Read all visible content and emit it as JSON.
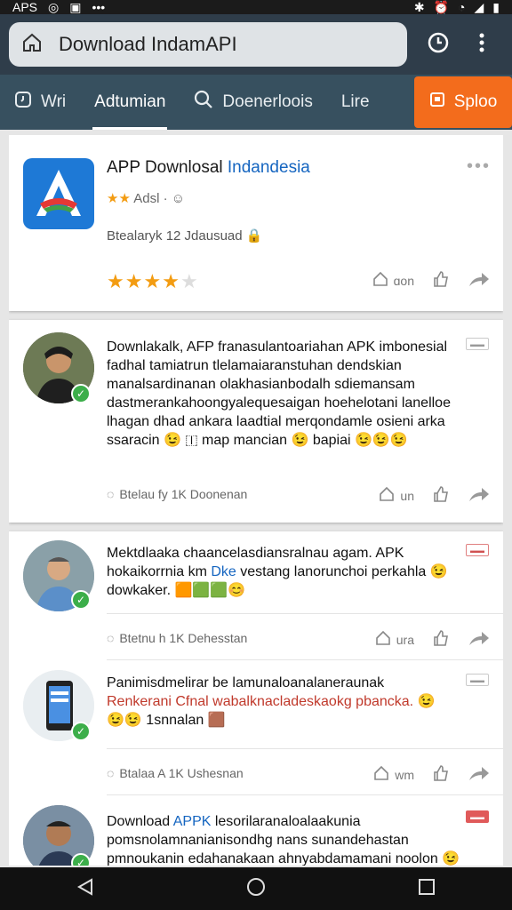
{
  "status": {
    "left_label": "APS"
  },
  "urlbar": {
    "url": "Download IndamAPI"
  },
  "tabs": [
    {
      "label": "Wri"
    },
    {
      "label": "Adtumian"
    },
    {
      "label": "Doenerloois"
    },
    {
      "label": "Lire"
    },
    {
      "label": "Sploo"
    }
  ],
  "app_card": {
    "title_part1": "APP Downlosal ",
    "title_part2": "Indandesia",
    "sub": "Adsl · ☺",
    "meta": "Btealaryk 12 Jdausuad",
    "rating": 4,
    "rating_max": 5,
    "share_label": "ɑon"
  },
  "posts": [
    {
      "text": "Downlakalk, AFP franasulantoariahan APK imbonesial fadhal tamiatrun tlelamaiaranstuhan dendskian manalsardinanan olakhasianbodalh sdiemansam dastmerankahoongyalequesaigan hoehelotani lanelloe lhagan dhad ankara laadtial merqondamle osieni arka ssaracin 😉 🇮 map mancian 😉 bapiai 😉😉😉",
      "footer": "Btelau fy 1K Doonenan",
      "action": "un"
    },
    {
      "text_part1": "Mektdlaaka chaancelasdiansralnau agam. APK hokaikorrnia km ",
      "text_blue": "Dke",
      "text_part2": " vestang lanorunchoi perkahla 😉 dowkaker. 🟧🟩🟩😊",
      "footer": "Btetnu h 1K Dehesstan",
      "action": "ura"
    },
    {
      "line1": "Panimisdmelirar be lamunaloanalaneraunak",
      "line2_red": "Renkerani Cfnal wabalknacladeskaokg pbancka. 😉",
      "line3": "😉😉 1snnalan 🟫",
      "footer": "Btalaa A 1K Ushesnan",
      "action": "wm"
    },
    {
      "text_part1": "Download ",
      "text_blue": "APPK",
      "text_part2": " lesorilaranaloalaakunia pomsnolamnanianisondhg nans sunandehastan pmnoukanin edahanakaan ahnyabdamamani noolon 😉 sanbarnarmalisamanarahabiolandavan"
    }
  ]
}
